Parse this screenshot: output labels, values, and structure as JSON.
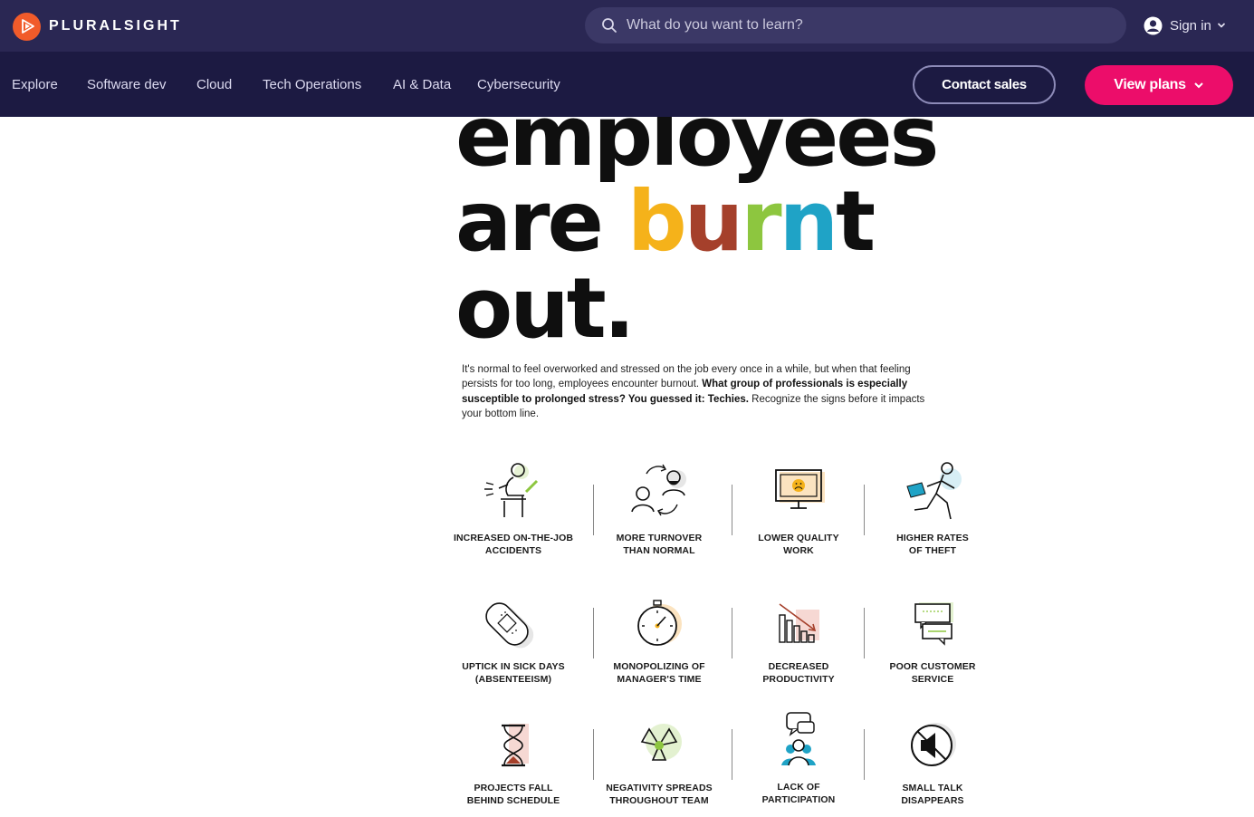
{
  "brand": {
    "name": "PLURALSIGHT"
  },
  "search": {
    "placeholder": "What do you want to learn?"
  },
  "account": {
    "signin_label": "Sign in"
  },
  "nav": {
    "items": [
      "Explore",
      "Software dev",
      "Cloud",
      "Tech Operations",
      "AI & Data",
      "Cybersecurity"
    ],
    "contact_label": "Contact sales",
    "plans_label": "View plans"
  },
  "colors": {
    "topbar": "#2a2753",
    "navbar": "#1c1a42",
    "accent_pink": "#ec0d6a",
    "brand_orange": "#f15b2a",
    "burnt_b": "#f5b21a",
    "burnt_u": "#a5402b",
    "burnt_r": "#8dc63f",
    "burnt_n": "#1fa3c6"
  },
  "headline": {
    "line1": "employees",
    "line2_start": "are ",
    "burnt": [
      "b",
      "u",
      "r",
      "n",
      "t"
    ],
    "line3": "out."
  },
  "intro": {
    "part1": "It's normal to feel overworked and stressed on the job every once in a while, but when that feeling persists for too long, employees encounter burnout. ",
    "bold": "What group of professionals is especially susceptible to prolonged stress? You guessed it: Techies.",
    "part2": " Recognize the signs before it impacts your bottom line."
  },
  "signs": [
    {
      "icon": "sitting-accident-icon",
      "line1": "INCREASED ON-THE-JOB",
      "line2": "ACCIDENTS"
    },
    {
      "icon": "turnover-people-icon",
      "line1": "MORE TURNOVER",
      "line2": "THAN NORMAL"
    },
    {
      "icon": "sad-monitor-icon",
      "line1": "LOWER QUALITY",
      "line2": "WORK"
    },
    {
      "icon": "running-thief-icon",
      "line1": "HIGHER RATES",
      "line2": "OF THEFT"
    },
    {
      "icon": "bandage-icon",
      "line1": "UPTICK IN SICK DAYS",
      "line2": "(ABSENTEEISM)"
    },
    {
      "icon": "stopwatch-icon",
      "line1": "MONOPOLIZING OF",
      "line2": "MANAGER'S TIME"
    },
    {
      "icon": "declining-chart-icon",
      "line1": "DECREASED",
      "line2": "PRODUCTIVITY"
    },
    {
      "icon": "chat-bubbles-icon",
      "line1": "POOR CUSTOMER",
      "line2": "SERVICE"
    },
    {
      "icon": "hourglass-icon",
      "line1": "PROJECTS FALL",
      "line2": "BEHIND SCHEDULE"
    },
    {
      "icon": "radiation-icon",
      "line1": "NEGATIVITY SPREADS",
      "line2": "THROUGHOUT TEAM"
    },
    {
      "icon": "group-speech-icon",
      "line1": "LACK OF",
      "line2": "PARTICIPATION"
    },
    {
      "icon": "muted-speaker-icon",
      "line1": "SMALL TALK",
      "line2": "DISAPPEARS"
    }
  ]
}
